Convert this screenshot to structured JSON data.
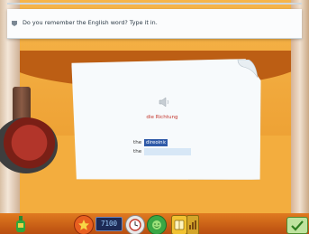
{
  "instruction": {
    "text": "Do you remember the English word? Type it in."
  },
  "exercise": {
    "german_word": "die Richtung",
    "rows": [
      {
        "article": "the",
        "value": "direoinic",
        "active": true
      },
      {
        "article": "the",
        "value": "",
        "active": false
      }
    ]
  },
  "toolbar": {
    "counter": "7100"
  },
  "colors": {
    "accent_red": "#c3352c",
    "input_selected": "#2f5aa8",
    "input_empty": "#d7e7f6"
  },
  "icons": {
    "speaker": "speaker-icon",
    "check": "checkmark-icon",
    "instruction": "pin-icon"
  }
}
